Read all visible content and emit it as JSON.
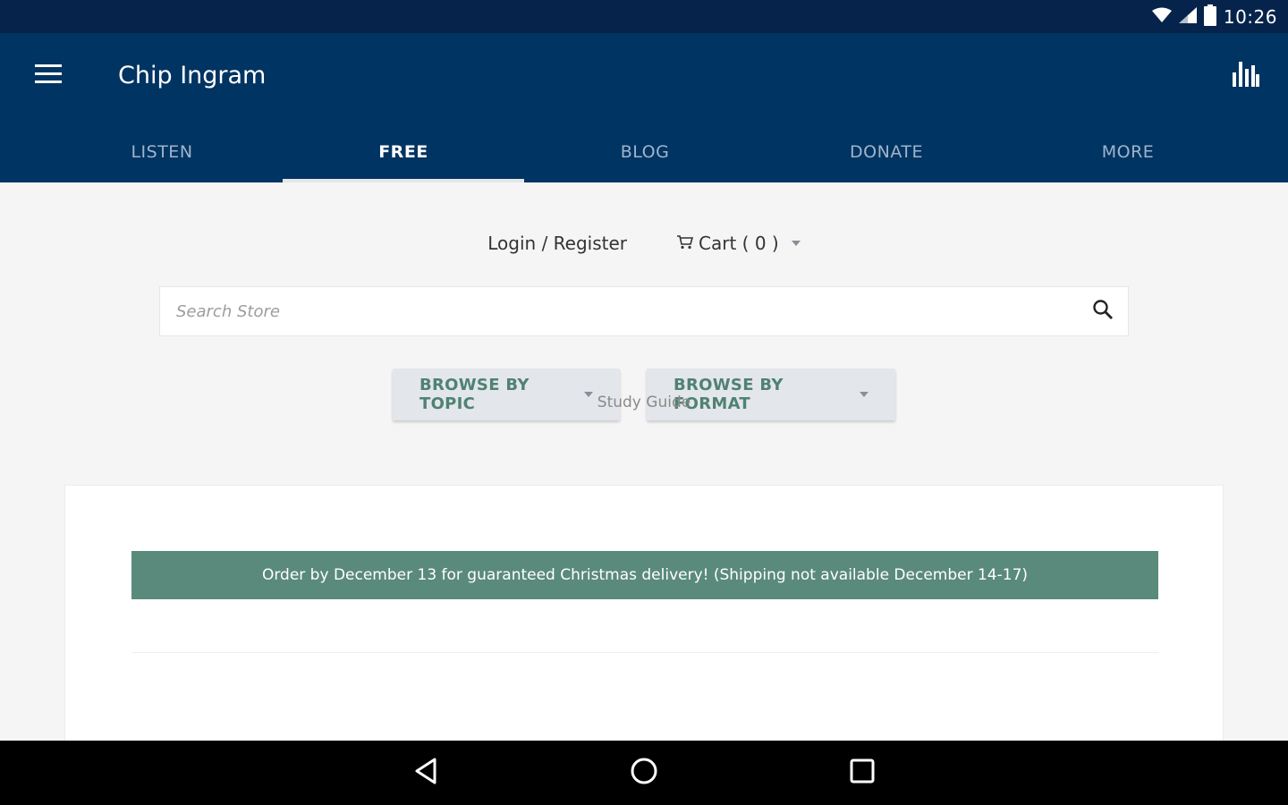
{
  "status_bar": {
    "time": "10:26",
    "icons": [
      "wifi-icon",
      "signal-icon",
      "battery-icon"
    ]
  },
  "app_bar": {
    "title": "Chip Ingram",
    "icons": [
      "menu-icon",
      "stats-icon"
    ],
    "tabs": [
      {
        "label": "LISTEN",
        "active": false
      },
      {
        "label": "FREE",
        "active": true
      },
      {
        "label": "BLOG",
        "active": false
      },
      {
        "label": "DONATE",
        "active": false
      },
      {
        "label": "MORE",
        "active": false
      }
    ]
  },
  "store": {
    "login_label": "Login / Register",
    "cart_label": "Cart ( 0 )",
    "search_placeholder": "Search Store",
    "browse_topic_label": "BROWSE BY TOPIC",
    "browse_format_label": "BROWSE BY FORMAT",
    "notice": "Order by December 13 for guaranteed Christmas delivery! (Shipping not available December 14-17)",
    "section_label": "Study Guide"
  },
  "nav_bar": {
    "icons": [
      "back-icon",
      "home-icon",
      "recents-icon"
    ]
  },
  "colors": {
    "status_bar": "#06244b",
    "app_bar": "#003462",
    "notice_bg": "#5a8a7b",
    "browse_text": "#4f8272",
    "browse_bg": "#e3e6ea"
  }
}
